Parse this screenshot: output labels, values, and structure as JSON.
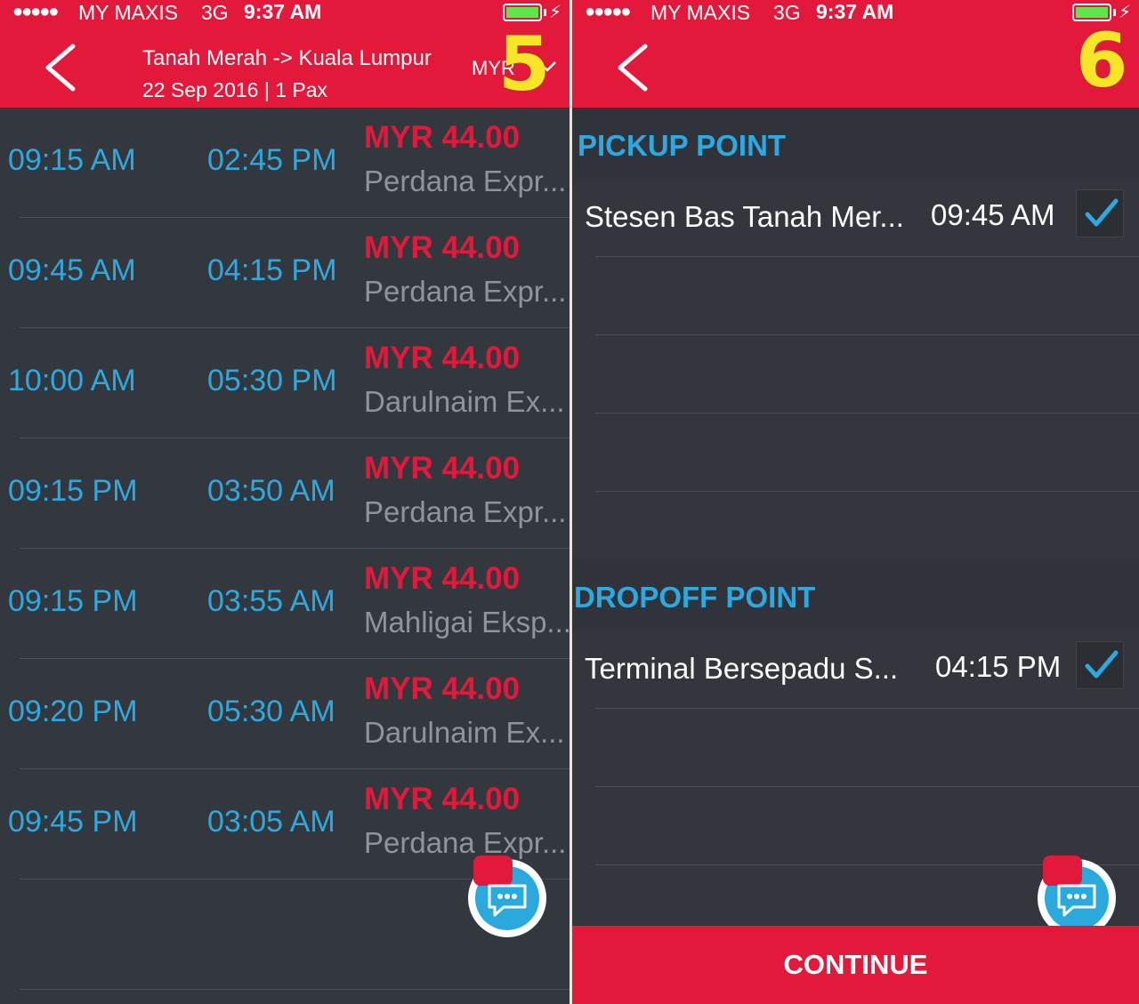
{
  "status_bar": {
    "signal": "●●●●●",
    "carrier": "MY MAXIS",
    "network": "3G",
    "time": "9:37 AM",
    "charging_icon": "⚡"
  },
  "screen5": {
    "title": "Tanah Merah -> Kuala Lumpur",
    "subtitle": "22 Sep 2016 | 1 Pax",
    "currency": "MYR",
    "step_badge": "5",
    "trips": [
      {
        "depart": "09:15 AM",
        "arrive": "02:45 PM",
        "price": "MYR 44.00",
        "operator": "Perdana Expr..."
      },
      {
        "depart": "09:45 AM",
        "arrive": "04:15 PM",
        "price": "MYR 44.00",
        "operator": "Perdana Expr..."
      },
      {
        "depart": "10:00 AM",
        "arrive": "05:30 PM",
        "price": "MYR 44.00",
        "operator": "Darulnaim Ex..."
      },
      {
        "depart": "09:15 PM",
        "arrive": "03:50 AM",
        "price": "MYR 44.00",
        "operator": "Perdana Expr..."
      },
      {
        "depart": "09:15 PM",
        "arrive": "03:55 AM",
        "price": "MYR 44.00",
        "operator": "Mahligai Eksp..."
      },
      {
        "depart": "09:20 PM",
        "arrive": "05:30 AM",
        "price": "MYR 44.00",
        "operator": "Darulnaim Ex..."
      },
      {
        "depart": "09:45 PM",
        "arrive": "03:05 AM",
        "price": "MYR 44.00",
        "operator": "Perdana Expr..."
      }
    ]
  },
  "screen6": {
    "step_badge": "6",
    "pickup": {
      "heading": "PICKUP POINT",
      "name": "Stesen Bas Tanah Mer...",
      "time": "09:45 AM",
      "checked": true
    },
    "dropoff": {
      "heading": "DROPOFF POINT",
      "name": "Terminal Bersepadu S...",
      "time": "04:15 PM",
      "checked": true
    },
    "continue_label": "CONTINUE"
  },
  "colors": {
    "brand_red": "#e3193b",
    "accent_blue": "#2da9e1",
    "background": "#33373e",
    "badge_yellow": "#f7e627"
  },
  "icons": [
    "back-chevron-icon",
    "dropdown-chevron-icon",
    "battery-icon",
    "checkbox-checked-icon",
    "chat-icon"
  ]
}
